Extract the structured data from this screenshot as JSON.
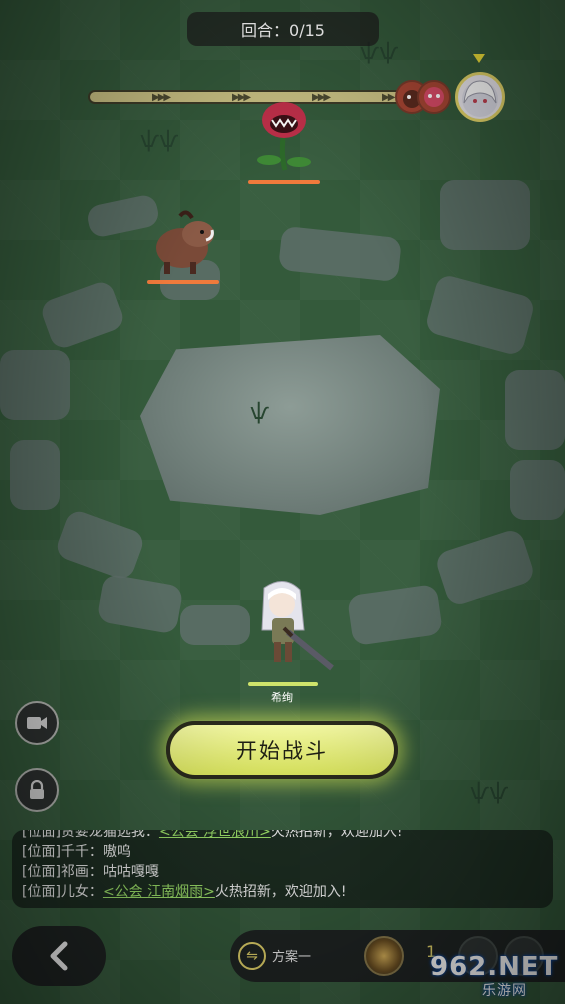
{
  "hud": {
    "round_label": "回合：0/15",
    "turn_order": [
      "enemy-1-portrait",
      "enemy-2-portrait",
      "hero-portrait"
    ]
  },
  "units": {
    "hero_name": "希绚",
    "enemy_hp": [
      1,
      1
    ],
    "hero_hp": 1
  },
  "buttons": {
    "start_battle": "开始战斗"
  },
  "chat": {
    "lines": [
      {
        "prefix": "[位面]贪婪龙猫选我：",
        "guild": "<公会 浮世浪川>",
        "suffix": "火热招新，欢迎加入!"
      },
      {
        "prefix": "[位面]千千：",
        "guild": "",
        "suffix": "嗷呜"
      },
      {
        "prefix": "[位面]祁画：",
        "guild": "",
        "suffix": "咕咕嘎嘎"
      },
      {
        "prefix": "[位面]儿女：",
        "guild": "<公会 江南烟雨>",
        "suffix": "火热招新，欢迎加入!"
      }
    ]
  },
  "bottom": {
    "plan_label": "方案一",
    "skill_count": "1",
    "watermark": "962.NET",
    "watermark_sub": "乐游网"
  },
  "icons": {
    "video": "video-camera-icon",
    "lock": "lock-icon",
    "back": "chevron-left-icon",
    "swap": "swap-icon"
  },
  "colors": {
    "accent": "#dde85f",
    "enemy_hp": "#f07a3c",
    "hero_hp": "#cfe46b",
    "guild_link": "#9fe36b"
  }
}
